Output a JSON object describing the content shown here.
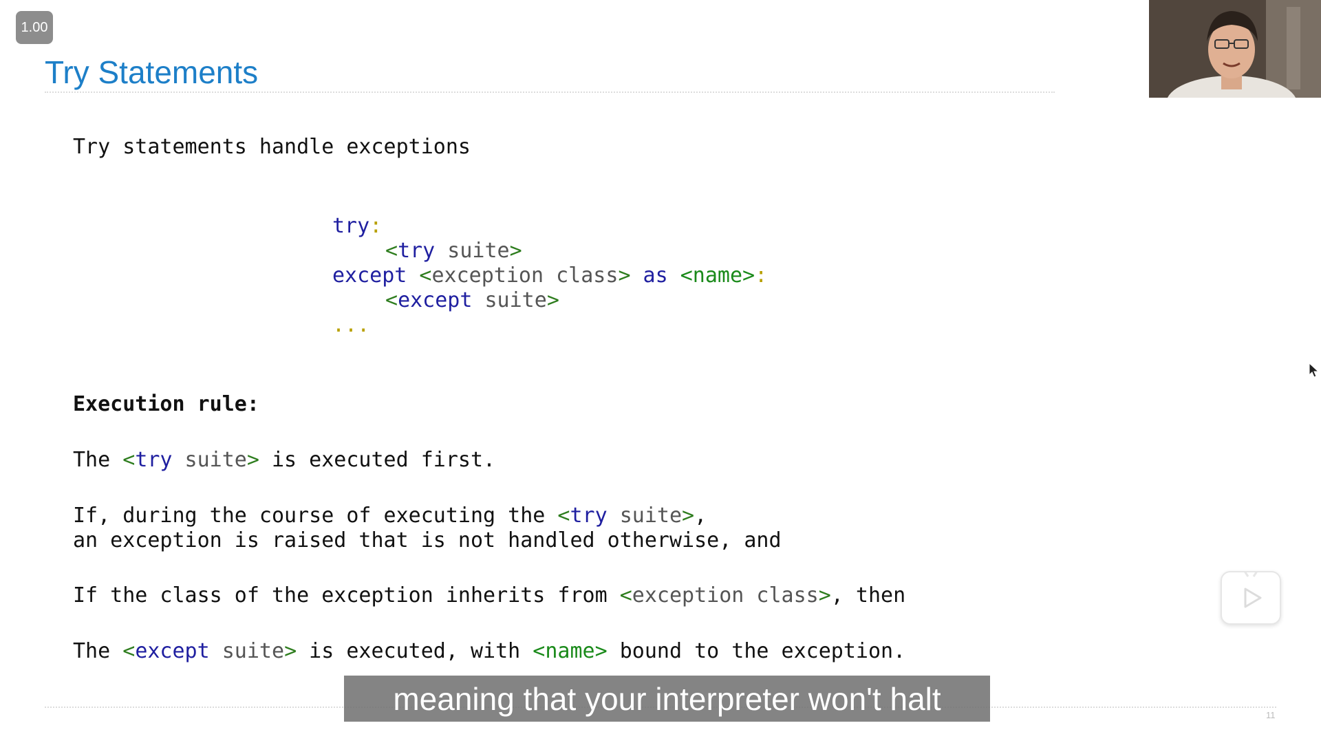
{
  "player": {
    "speed_badge": "1.00",
    "caption": "meaning that your interpreter won't halt",
    "page_number": "11",
    "play_icon": "play-icon"
  },
  "slide": {
    "title": "Try Statements",
    "intro": "Try statements handle exceptions",
    "code": {
      "line1_kw": "try",
      "line1_colon": ":",
      "line2_open": "<",
      "line2_kw": "try",
      "line2_text": " suite",
      "line2_close": ">",
      "line3_kw": "except",
      "line3_open": " <",
      "line3_text": "exception class",
      "line3_close": ">",
      "line3_as": " as ",
      "line3_name": "<name>",
      "line3_colon": ":",
      "line4_open": "<",
      "line4_kw": "except",
      "line4_text": " suite",
      "line4_close": ">",
      "line5": "..."
    },
    "rule_heading": "Execution rule:",
    "rule1": {
      "pre": "The ",
      "open": "<",
      "kw": "try",
      "text": " suite",
      "close": ">",
      "post": " is executed first."
    },
    "rule2": {
      "pre": "If, during the course of executing the ",
      "open": "<",
      "kw": "try",
      "text": " suite",
      "close": ">",
      "post": ",",
      "line2": "an exception is raised that is not handled otherwise, and"
    },
    "rule3": {
      "pre": "If the class of the exception inherits from ",
      "open": "<",
      "text": "exception class",
      "close": ">",
      "post": ", then"
    },
    "rule4": {
      "pre": "The ",
      "open": "<",
      "kw": "except",
      "text": " suite",
      "close": ">",
      "mid": " is executed, with ",
      "name": "<name>",
      "post": " bound to the exception."
    }
  }
}
